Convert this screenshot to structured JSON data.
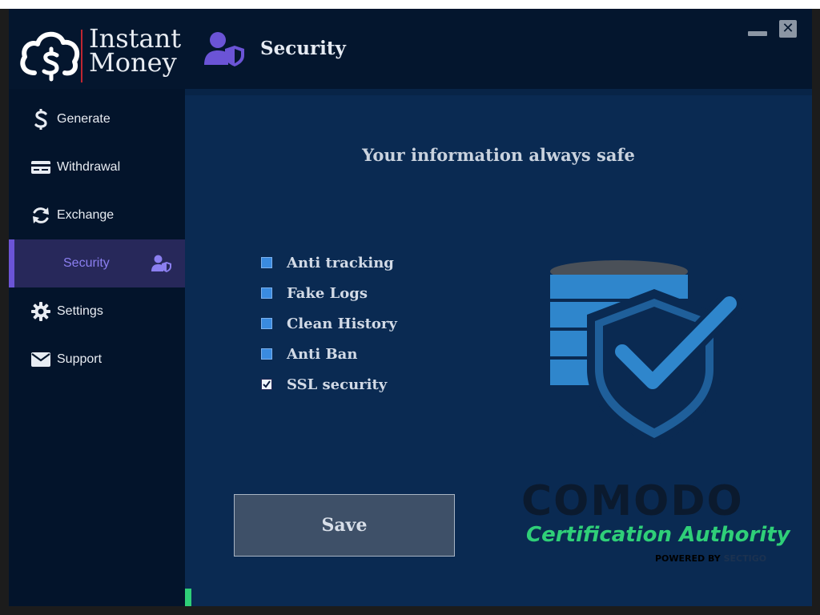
{
  "app": {
    "logo_line1": "Instant",
    "logo_line2": "Money",
    "page_title": "Security"
  },
  "window": {
    "minimize_glyph": "—",
    "close_glyph": "✕"
  },
  "sidebar": {
    "items": [
      {
        "label": "Generate",
        "icon": "dollar-icon"
      },
      {
        "label": "Withdrawal",
        "icon": "card-icon"
      },
      {
        "label": "Exchange",
        "icon": "refresh-icon"
      },
      {
        "label": "Security",
        "icon": "user-shield-icon",
        "active": true
      },
      {
        "label": "Settings",
        "icon": "gear-icon"
      },
      {
        "label": "Support",
        "icon": "envelope-icon"
      }
    ]
  },
  "main": {
    "heading": "Your information always safe",
    "options": [
      {
        "label": "Anti tracking",
        "checked": false
      },
      {
        "label": "Fake Logs",
        "checked": false
      },
      {
        "label": "Clean History",
        "checked": false
      },
      {
        "label": "Anti Ban",
        "checked": false
      },
      {
        "label": "SSL security",
        "checked": true
      }
    ],
    "save_label": "Save",
    "progress": 0.01
  },
  "badge": {
    "brand": "COMODO",
    "tagline": "Certification Authority",
    "powered_prefix": "POWERED BY ",
    "powered_brand": "SECTIGO"
  },
  "colors": {
    "accent": "#6b54d6",
    "active_bg": "#27285a",
    "checkbox": "#3a8be0",
    "comodo_green": "#2fcf78",
    "shield_blue": "#2f86cc"
  }
}
